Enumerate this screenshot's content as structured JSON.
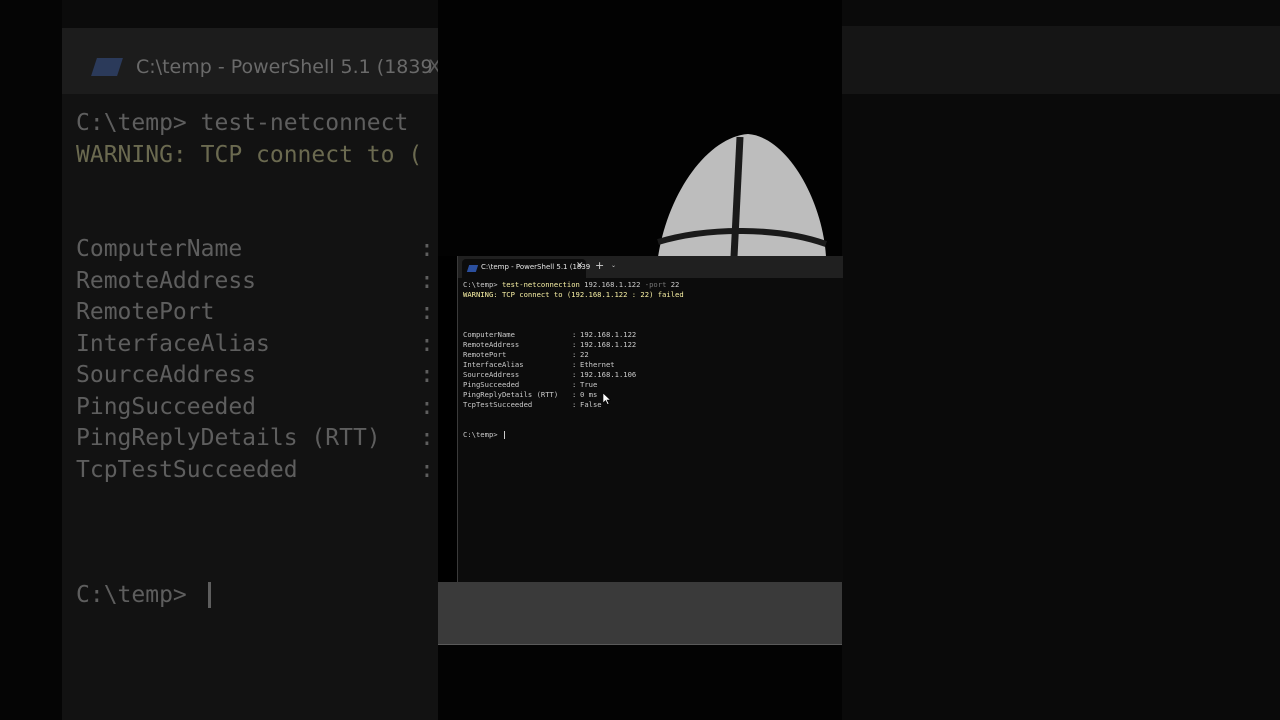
{
  "window": {
    "tab_title": "C:\\temp - PowerShell 5.1 (1839",
    "tab_close": "✕",
    "new_tab": "+",
    "dropdown": "⌄"
  },
  "console": {
    "prompt": "C:\\temp>",
    "command": "test-netconnection",
    "address": "192.168.1.122",
    "param": "-port",
    "port": "22",
    "warning": "WARNING: TCP connect to (192.168.1.122 : 22) failed",
    "properties": [
      {
        "name": "ComputerName",
        "value": "192.168.1.122"
      },
      {
        "name": "RemoteAddress",
        "value": "192.168.1.122"
      },
      {
        "name": "RemotePort",
        "value": "22"
      },
      {
        "name": "InterfaceAlias",
        "value": "Ethernet"
      },
      {
        "name": "SourceAddress",
        "value": "192.168.1.106"
      },
      {
        "name": "PingSucceeded",
        "value": "True"
      },
      {
        "name": "PingReplyDetails (RTT)",
        "value": "0 ms"
      },
      {
        "name": "TcpTestSucceeded",
        "value": "False"
      }
    ],
    "separator": ":",
    "final_prompt": "C:\\temp>"
  },
  "background": {
    "tab_title": "C:\\temp - PowerShell 5.1 (1839",
    "tab_close": "X",
    "line1": "C:\\temp> test-netconnect",
    "line2": "WARNING: TCP connect to (",
    "props": [
      "ComputerName",
      "RemoteAddress",
      "RemotePort",
      "InterfaceAlias",
      "SourceAddress",
      "PingSucceeded",
      "PingReplyDetails (RTT)",
      "TcpTestSucceeded"
    ],
    "prompt": "C:\\temp>"
  }
}
